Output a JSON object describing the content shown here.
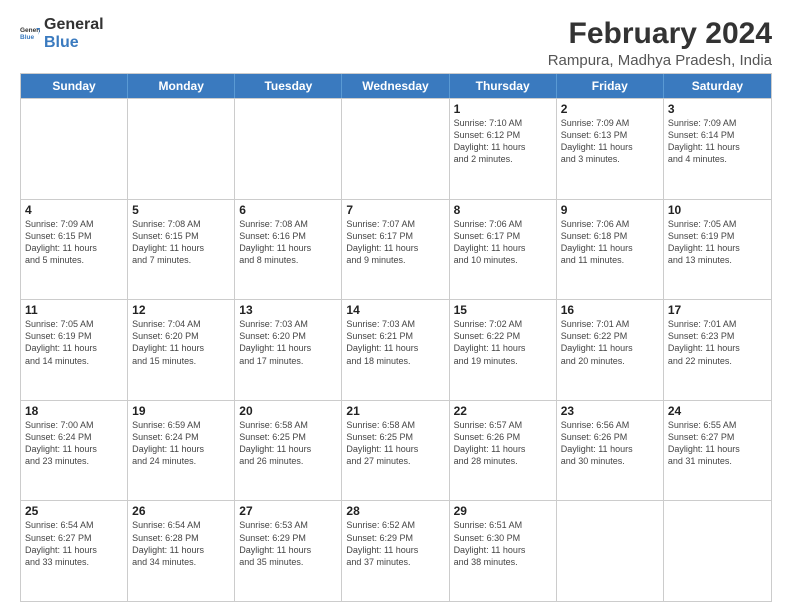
{
  "logo": {
    "general": "General",
    "blue": "Blue"
  },
  "title": "February 2024",
  "subtitle": "Rampura, Madhya Pradesh, India",
  "header": {
    "days": [
      "Sunday",
      "Monday",
      "Tuesday",
      "Wednesday",
      "Thursday",
      "Friday",
      "Saturday"
    ]
  },
  "weeks": [
    [
      {
        "day": "",
        "info": ""
      },
      {
        "day": "",
        "info": ""
      },
      {
        "day": "",
        "info": ""
      },
      {
        "day": "",
        "info": ""
      },
      {
        "day": "1",
        "info": "Sunrise: 7:10 AM\nSunset: 6:12 PM\nDaylight: 11 hours\nand 2 minutes."
      },
      {
        "day": "2",
        "info": "Sunrise: 7:09 AM\nSunset: 6:13 PM\nDaylight: 11 hours\nand 3 minutes."
      },
      {
        "day": "3",
        "info": "Sunrise: 7:09 AM\nSunset: 6:14 PM\nDaylight: 11 hours\nand 4 minutes."
      }
    ],
    [
      {
        "day": "4",
        "info": "Sunrise: 7:09 AM\nSunset: 6:15 PM\nDaylight: 11 hours\nand 5 minutes."
      },
      {
        "day": "5",
        "info": "Sunrise: 7:08 AM\nSunset: 6:15 PM\nDaylight: 11 hours\nand 7 minutes."
      },
      {
        "day": "6",
        "info": "Sunrise: 7:08 AM\nSunset: 6:16 PM\nDaylight: 11 hours\nand 8 minutes."
      },
      {
        "day": "7",
        "info": "Sunrise: 7:07 AM\nSunset: 6:17 PM\nDaylight: 11 hours\nand 9 minutes."
      },
      {
        "day": "8",
        "info": "Sunrise: 7:06 AM\nSunset: 6:17 PM\nDaylight: 11 hours\nand 10 minutes."
      },
      {
        "day": "9",
        "info": "Sunrise: 7:06 AM\nSunset: 6:18 PM\nDaylight: 11 hours\nand 11 minutes."
      },
      {
        "day": "10",
        "info": "Sunrise: 7:05 AM\nSunset: 6:19 PM\nDaylight: 11 hours\nand 13 minutes."
      }
    ],
    [
      {
        "day": "11",
        "info": "Sunrise: 7:05 AM\nSunset: 6:19 PM\nDaylight: 11 hours\nand 14 minutes."
      },
      {
        "day": "12",
        "info": "Sunrise: 7:04 AM\nSunset: 6:20 PM\nDaylight: 11 hours\nand 15 minutes."
      },
      {
        "day": "13",
        "info": "Sunrise: 7:03 AM\nSunset: 6:20 PM\nDaylight: 11 hours\nand 17 minutes."
      },
      {
        "day": "14",
        "info": "Sunrise: 7:03 AM\nSunset: 6:21 PM\nDaylight: 11 hours\nand 18 minutes."
      },
      {
        "day": "15",
        "info": "Sunrise: 7:02 AM\nSunset: 6:22 PM\nDaylight: 11 hours\nand 19 minutes."
      },
      {
        "day": "16",
        "info": "Sunrise: 7:01 AM\nSunset: 6:22 PM\nDaylight: 11 hours\nand 20 minutes."
      },
      {
        "day": "17",
        "info": "Sunrise: 7:01 AM\nSunset: 6:23 PM\nDaylight: 11 hours\nand 22 minutes."
      }
    ],
    [
      {
        "day": "18",
        "info": "Sunrise: 7:00 AM\nSunset: 6:24 PM\nDaylight: 11 hours\nand 23 minutes."
      },
      {
        "day": "19",
        "info": "Sunrise: 6:59 AM\nSunset: 6:24 PM\nDaylight: 11 hours\nand 24 minutes."
      },
      {
        "day": "20",
        "info": "Sunrise: 6:58 AM\nSunset: 6:25 PM\nDaylight: 11 hours\nand 26 minutes."
      },
      {
        "day": "21",
        "info": "Sunrise: 6:58 AM\nSunset: 6:25 PM\nDaylight: 11 hours\nand 27 minutes."
      },
      {
        "day": "22",
        "info": "Sunrise: 6:57 AM\nSunset: 6:26 PM\nDaylight: 11 hours\nand 28 minutes."
      },
      {
        "day": "23",
        "info": "Sunrise: 6:56 AM\nSunset: 6:26 PM\nDaylight: 11 hours\nand 30 minutes."
      },
      {
        "day": "24",
        "info": "Sunrise: 6:55 AM\nSunset: 6:27 PM\nDaylight: 11 hours\nand 31 minutes."
      }
    ],
    [
      {
        "day": "25",
        "info": "Sunrise: 6:54 AM\nSunset: 6:27 PM\nDaylight: 11 hours\nand 33 minutes."
      },
      {
        "day": "26",
        "info": "Sunrise: 6:54 AM\nSunset: 6:28 PM\nDaylight: 11 hours\nand 34 minutes."
      },
      {
        "day": "27",
        "info": "Sunrise: 6:53 AM\nSunset: 6:29 PM\nDaylight: 11 hours\nand 35 minutes."
      },
      {
        "day": "28",
        "info": "Sunrise: 6:52 AM\nSunset: 6:29 PM\nDaylight: 11 hours\nand 37 minutes."
      },
      {
        "day": "29",
        "info": "Sunrise: 6:51 AM\nSunset: 6:30 PM\nDaylight: 11 hours\nand 38 minutes."
      },
      {
        "day": "",
        "info": ""
      },
      {
        "day": "",
        "info": ""
      }
    ]
  ]
}
